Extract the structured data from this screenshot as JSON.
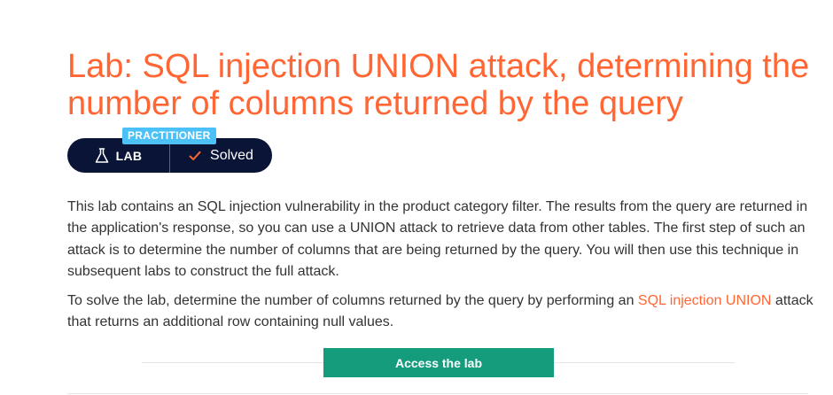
{
  "header": {
    "title": "Lab: SQL injection UNION attack, determining the number of columns returned by the query"
  },
  "badge": {
    "level": "PRACTITIONER",
    "type_label": "LAB",
    "type_icon": "flask-icon",
    "status_label": "Solved",
    "status_icon": "checkmark-icon"
  },
  "description": {
    "paragraph1": "This lab contains an SQL injection vulnerability in the product category filter. The results from the query are returned in the application's response, so you can use a UNION attack to retrieve data from other tables. The first step of such an attack is to determine the number of columns that are being returned by the query. You will then use this technique in subsequent labs to construct the full attack.",
    "paragraph2_before": "To solve the lab, determine the number of columns returned by the query by performing an ",
    "paragraph2_link": "SQL injection UNION",
    "paragraph2_after": " attack that returns an additional row containing null values."
  },
  "actions": {
    "access_label": "Access the lab"
  },
  "colors": {
    "accent": "#ff6633",
    "pill_background": "#0a1436",
    "level_badge": "#4cc1f7",
    "button": "#149c7c",
    "check": "#ff6633"
  }
}
